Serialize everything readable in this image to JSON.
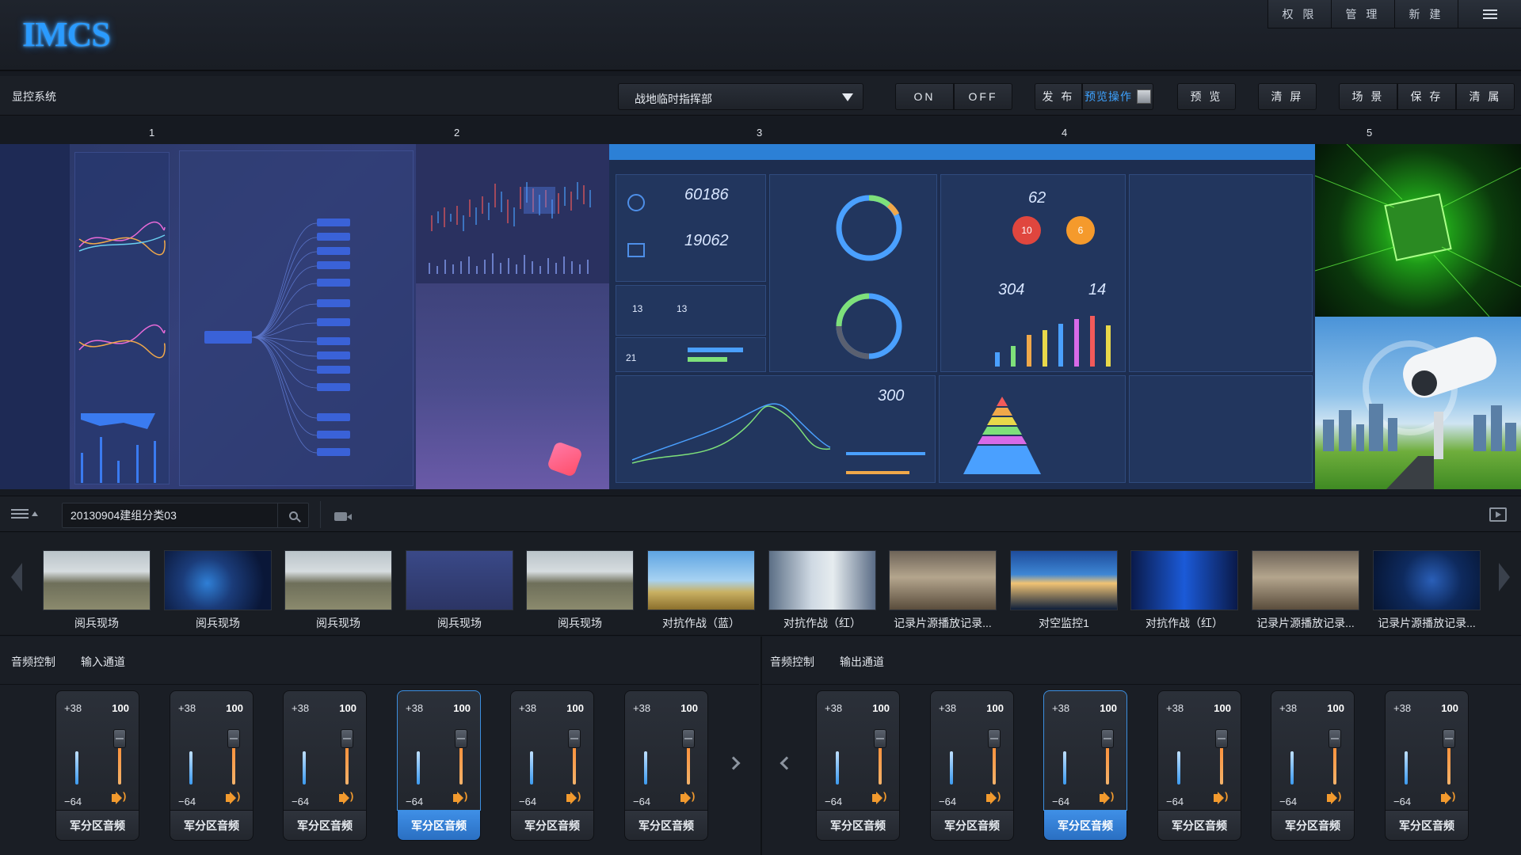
{
  "app": {
    "logo": "IMCS"
  },
  "top_menu": [
    "权 限",
    "管 理",
    "新 建"
  ],
  "toolbar": {
    "system_label": "显控系统",
    "scene": "战地临时指挥部",
    "on": "ON",
    "off": "OFF",
    "publish": "发 布",
    "preview_op": "预览操作",
    "preview": "预 览",
    "clear_screen": "清 屏",
    "scene_btn": "场 景",
    "save": "保 存",
    "clear_layer": "清 属"
  },
  "columns": [
    "1",
    "2",
    "3",
    "4",
    "5"
  ],
  "wall": {
    "pane3": {
      "stat1": "60186",
      "stat2": "19062",
      "stat3": "13",
      "stat4": "13",
      "stat5": "21",
      "stat6": "62",
      "stat7": "10",
      "stat8": "6",
      "stat9": "304",
      "stat10": "14",
      "stat11": "300"
    }
  },
  "source": {
    "group_value": "20130904建组分类03"
  },
  "thumbnails": [
    {
      "label": "阅兵现场",
      "img": "parade"
    },
    {
      "label": "阅兵现场",
      "img": "map"
    },
    {
      "label": "阅兵现场",
      "img": "parade"
    },
    {
      "label": "阅兵现场",
      "img": "ui"
    },
    {
      "label": "阅兵现场",
      "img": "parade"
    },
    {
      "label": "对抗作战（蓝）",
      "img": "artillery"
    },
    {
      "label": "对抗作战（红）",
      "img": "woman"
    },
    {
      "label": "记录片源播放记录...",
      "img": "tank"
    },
    {
      "label": "对空监控1",
      "img": "sunset"
    },
    {
      "label": "对抗作战（红）",
      "img": "server"
    },
    {
      "label": "记录片源播放记录...",
      "img": "tank"
    },
    {
      "label": "记录片源播放记录...",
      "img": "map2"
    }
  ],
  "audio": {
    "input": {
      "title": "音频控制",
      "subtitle": "输入通道",
      "channels": [
        {
          "max": "+38",
          "volume": "100",
          "min": "−64",
          "name": "军分区音频",
          "selected": false
        },
        {
          "max": "+38",
          "volume": "100",
          "min": "−64",
          "name": "军分区音频",
          "selected": false
        },
        {
          "max": "+38",
          "volume": "100",
          "min": "−64",
          "name": "军分区音频",
          "selected": false
        },
        {
          "max": "+38",
          "volume": "100",
          "min": "−64",
          "name": "军分区音频",
          "selected": true
        },
        {
          "max": "+38",
          "volume": "100",
          "min": "−64",
          "name": "军分区音频",
          "selected": false
        },
        {
          "max": "+38",
          "volume": "100",
          "min": "−64",
          "name": "军分区音频",
          "selected": false
        }
      ]
    },
    "output": {
      "title": "音频控制",
      "subtitle": "输出通道",
      "channels": [
        {
          "max": "+38",
          "volume": "100",
          "min": "−64",
          "name": "军分区音频",
          "selected": false
        },
        {
          "max": "+38",
          "volume": "100",
          "min": "−64",
          "name": "军分区音频",
          "selected": false
        },
        {
          "max": "+38",
          "volume": "100",
          "min": "−64",
          "name": "军分区音频",
          "selected": true
        },
        {
          "max": "+38",
          "volume": "100",
          "min": "−64",
          "name": "军分区音频",
          "selected": false
        },
        {
          "max": "+38",
          "volume": "100",
          "min": "−64",
          "name": "军分区音频",
          "selected": false
        },
        {
          "max": "+38",
          "volume": "100",
          "min": "−64",
          "name": "军分区音频",
          "selected": false
        }
      ]
    }
  }
}
